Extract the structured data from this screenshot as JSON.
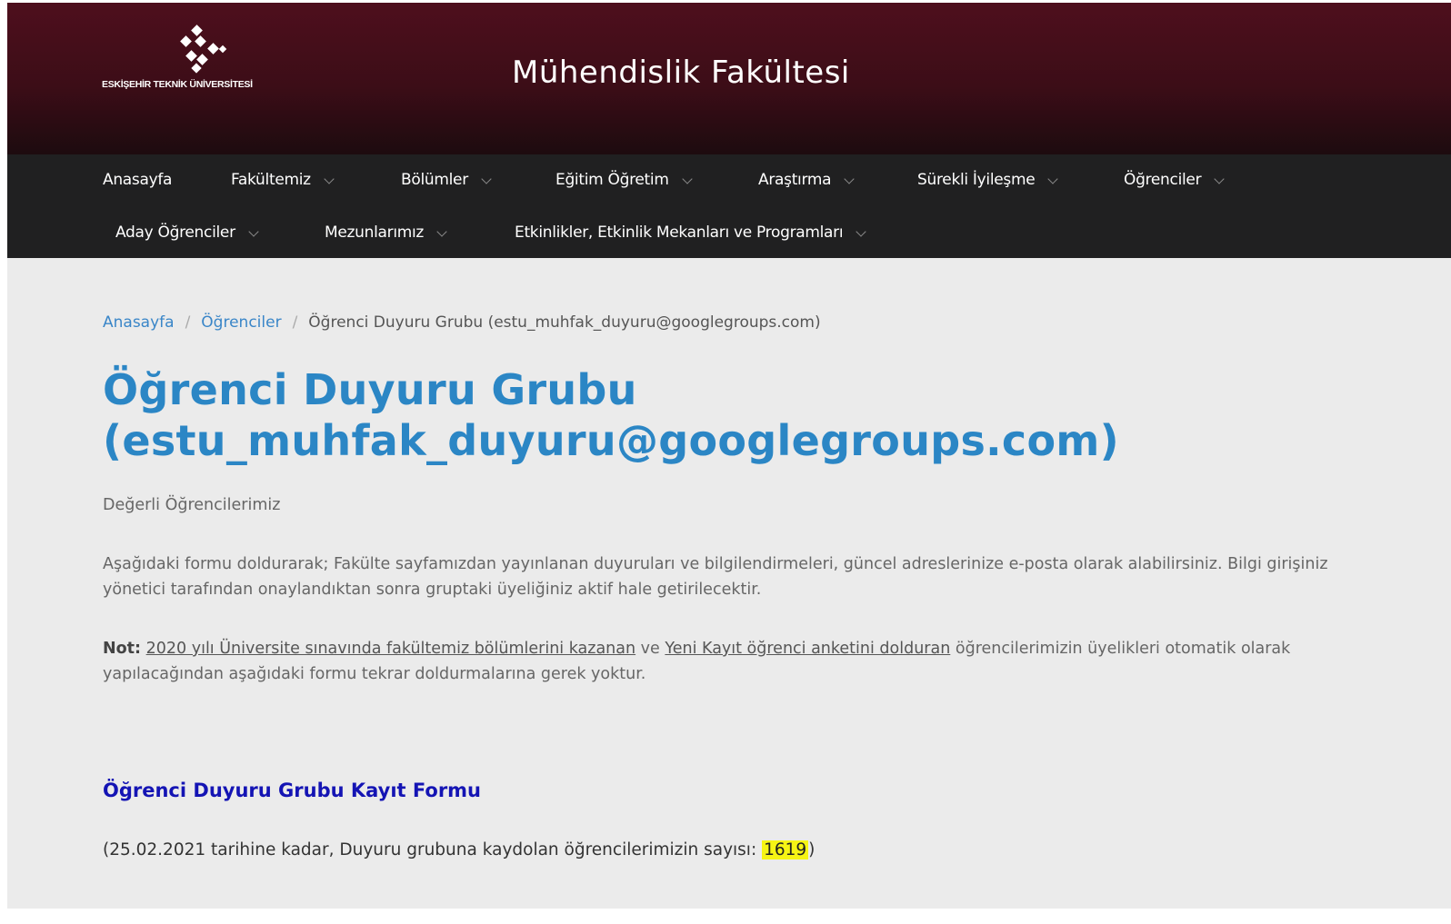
{
  "header": {
    "logo_text": "ESKİŞEHİR TEKNİK ÜNİVERSİTESİ",
    "logo_icon": "estu-logo-icon",
    "title": "Mühendislik Fakültesi",
    "colors": {
      "header_top": "#4e0f1d",
      "nav_bg": "#202021",
      "title_blue": "#2b86c5",
      "link_blue": "#1414b4",
      "highlight": "#f6f415"
    }
  },
  "nav": {
    "items": [
      {
        "label": "Anasayfa"
      },
      {
        "label": "Fakültemiz"
      },
      {
        "label": "Bölümler"
      },
      {
        "label": "Eğitim Öğretim"
      },
      {
        "label": "Araştırma"
      },
      {
        "label": "Sürekli İyileşme"
      },
      {
        "label": "Öğrenciler"
      },
      {
        "label": "Aday Öğrenciler"
      },
      {
        "label": "Mezunlarımız"
      },
      {
        "label": "Etkinlikler, Etkinlik Mekanları ve Programları"
      }
    ]
  },
  "breadcrumb": {
    "home": "Anasayfa",
    "section": "Öğrenciler",
    "current": "Öğrenci Duyuru Grubu (estu_muhfak_duyuru@googlegroups.com)"
  },
  "page": {
    "title_line1": "Öğrenci Duyuru Grubu",
    "title_line2": "(estu_muhfak_duyuru@googlegroups.com)",
    "greeting": "Değerli Öğrencilerimiz",
    "intro": "Aşağıdaki formu doldurarak; Fakülte sayfamızdan yayınlanan duyuruları ve bilgilendirmeleri, güncel adreslerinize e-posta olarak alabilirsiniz. Bilgi girişiniz yönetici tarafından onaylandıktan sonra gruptaki üyeliğiniz aktif hale getirilecektir.",
    "note_label": "Not:",
    "note_link1": "2020 yılı Üniversite sınavında fakültemiz bölümlerini kazanan",
    "note_and": "ve",
    "note_link2": "Yeni Kayıt öğrenci anketini dolduran",
    "note_rest": "öğrencilerimizin üyelikleri otomatik olarak yapılacağından aşağıdaki formu tekrar doldurmalarına gerek yoktur.",
    "form_link": "Öğrenci Duyuru Grubu Kayıt Formu",
    "count_prefix": "(25.02.2021 tarihine kadar, Duyuru grubuna kaydolan öğrencilerimizin sayısı:",
    "count_value": "1619",
    "count_suffix": ")"
  }
}
